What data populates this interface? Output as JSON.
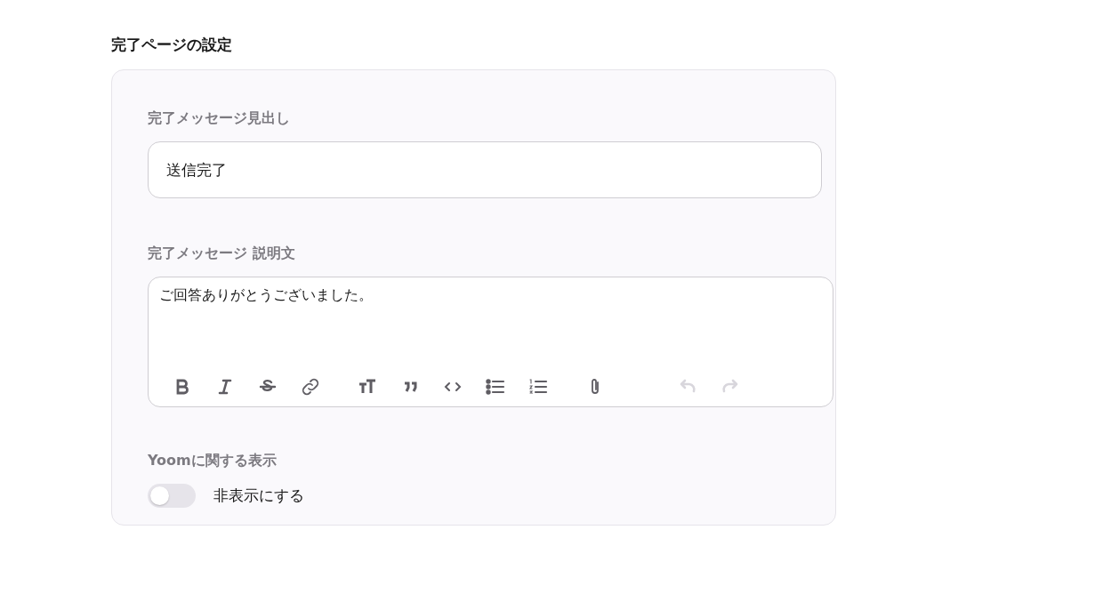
{
  "section_title": "完了ページの設定",
  "heading_field": {
    "label": "完了メッセージ見出し",
    "value": "送信完了"
  },
  "description_field": {
    "label": "完了メッセージ 説明文",
    "value": "ご回答ありがとうございました。",
    "toolbar": [
      [
        {
          "kind": "bold",
          "disabled": false
        },
        {
          "kind": "italic",
          "disabled": false
        },
        {
          "kind": "strike",
          "disabled": false
        },
        {
          "kind": "link",
          "disabled": false
        }
      ],
      [
        {
          "kind": "heading",
          "disabled": false
        },
        {
          "kind": "quote",
          "disabled": false
        },
        {
          "kind": "code",
          "disabled": false
        },
        {
          "kind": "bullets",
          "disabled": false
        },
        {
          "kind": "numbers",
          "disabled": false
        }
      ],
      [
        {
          "kind": "attach",
          "disabled": false
        }
      ],
      [
        {
          "kind": "undo",
          "disabled": true
        },
        {
          "kind": "redo",
          "disabled": true
        }
      ]
    ]
  },
  "yoom_display": {
    "label": "Yoomに関する表示",
    "toggle": {
      "label": "非表示にする",
      "on": false
    }
  }
}
